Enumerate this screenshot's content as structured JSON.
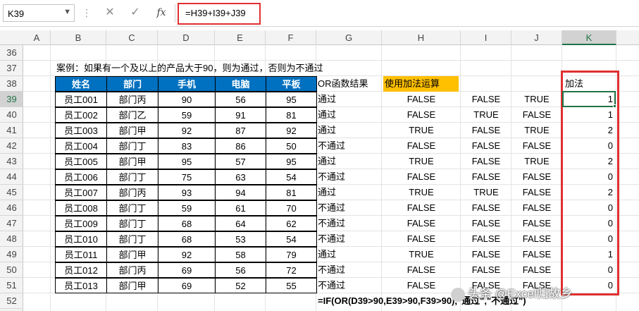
{
  "formula_bar": {
    "name_box": "K39",
    "fx_label": "fx",
    "cancel_glyph": "✕",
    "enter_glyph": "✓",
    "formula": "=H39+I39+J39"
  },
  "columns": [
    "A",
    "B",
    "C",
    "D",
    "E",
    "F",
    "G",
    "H",
    "I",
    "J",
    "K"
  ],
  "rows": [
    "36",
    "37",
    "38",
    "39",
    "40",
    "41",
    "42",
    "43",
    "44",
    "45",
    "46",
    "47",
    "48",
    "49",
    "50",
    "51",
    "52"
  ],
  "title": "案例：如果有一个及以上的产品大于90，则为通过，否则为不通过",
  "headers": {
    "name": "姓名",
    "dept": "部门",
    "phone": "手机",
    "pc": "电脑",
    "tablet": "平板",
    "or_result": "OR函数结果",
    "add_op": "使用加法运算",
    "add": "加法"
  },
  "records": [
    {
      "name": "员工001",
      "dept": "部门丙",
      "phone": "90",
      "pc": "56",
      "tablet": "95",
      "or": "通过",
      "h": "FALSE",
      "i": "FALSE",
      "j": "TRUE",
      "k": "1"
    },
    {
      "name": "员工002",
      "dept": "部门乙",
      "phone": "59",
      "pc": "91",
      "tablet": "81",
      "or": "通过",
      "h": "FALSE",
      "i": "TRUE",
      "j": "FALSE",
      "k": "1"
    },
    {
      "name": "员工003",
      "dept": "部门甲",
      "phone": "92",
      "pc": "87",
      "tablet": "92",
      "or": "通过",
      "h": "TRUE",
      "i": "FALSE",
      "j": "TRUE",
      "k": "2"
    },
    {
      "name": "员工004",
      "dept": "部门丁",
      "phone": "83",
      "pc": "86",
      "tablet": "50",
      "or": "不通过",
      "h": "FALSE",
      "i": "FALSE",
      "j": "FALSE",
      "k": "0"
    },
    {
      "name": "员工005",
      "dept": "部门甲",
      "phone": "95",
      "pc": "57",
      "tablet": "95",
      "or": "通过",
      "h": "TRUE",
      "i": "FALSE",
      "j": "TRUE",
      "k": "2"
    },
    {
      "name": "员工006",
      "dept": "部门丁",
      "phone": "75",
      "pc": "63",
      "tablet": "54",
      "or": "不通过",
      "h": "FALSE",
      "i": "FALSE",
      "j": "FALSE",
      "k": "0"
    },
    {
      "name": "员工007",
      "dept": "部门丙",
      "phone": "93",
      "pc": "94",
      "tablet": "81",
      "or": "通过",
      "h": "TRUE",
      "i": "TRUE",
      "j": "FALSE",
      "k": "2"
    },
    {
      "name": "员工008",
      "dept": "部门丁",
      "phone": "59",
      "pc": "61",
      "tablet": "70",
      "or": "不通过",
      "h": "FALSE",
      "i": "FALSE",
      "j": "FALSE",
      "k": "0"
    },
    {
      "name": "员工009",
      "dept": "部门丁",
      "phone": "68",
      "pc": "64",
      "tablet": "62",
      "or": "不通过",
      "h": "FALSE",
      "i": "FALSE",
      "j": "FALSE",
      "k": "0"
    },
    {
      "name": "员工010",
      "dept": "部门丁",
      "phone": "68",
      "pc": "53",
      "tablet": "54",
      "or": "不通过",
      "h": "FALSE",
      "i": "FALSE",
      "j": "FALSE",
      "k": "0"
    },
    {
      "name": "员工011",
      "dept": "部门甲",
      "phone": "92",
      "pc": "58",
      "tablet": "79",
      "or": "通过",
      "h": "TRUE",
      "i": "FALSE",
      "j": "FALSE",
      "k": "1"
    },
    {
      "name": "员工012",
      "dept": "部门丙",
      "phone": "69",
      "pc": "56",
      "tablet": "72",
      "or": "不通过",
      "h": "FALSE",
      "i": "FALSE",
      "j": "FALSE",
      "k": "0"
    },
    {
      "name": "员工013",
      "dept": "部门甲",
      "phone": "69",
      "pc": "52",
      "tablet": "55",
      "or": "不通过",
      "h": "FALSE",
      "i": "FALSE",
      "j": "FALSE",
      "k": "0"
    }
  ],
  "footer_formula": "=IF(OR(D39>90,E39>90,F39>90),\"通过\",\"不通过\")",
  "watermark": "头条 @Excel归故乡",
  "colors": {
    "header_blue": "#0070c0",
    "header_orange": "#ffc000",
    "highlight_red": "#e03030",
    "active_green": "#217346"
  }
}
